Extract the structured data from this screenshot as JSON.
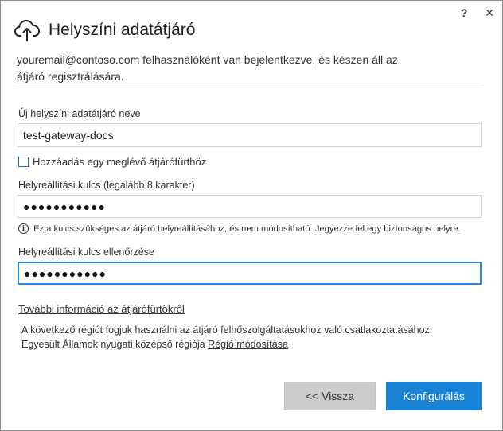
{
  "window": {
    "help_glyph": "?",
    "close_glyph": "✕"
  },
  "header": {
    "title": "Helyszíni adatátjáró",
    "icon": "cloud-upload-icon"
  },
  "intro": {
    "line1": "youremail@contoso.com felhasználóként van bejelentkezve, és készen áll az",
    "line2": "átjáró regisztrálására."
  },
  "form": {
    "name_label": "Új helyszíni adatátjáró neve",
    "name_value": "test-gateway-docs",
    "add_to_cluster_label": "Hozzáadás egy meglévő átjárófürthöz",
    "add_to_cluster_checked": false,
    "recovery_key_label": "Helyreállítási kulcs (legalább 8 karakter)",
    "recovery_key_value": "●●●●●●●●●●●",
    "recovery_key_info": "Ez a kulcs szükséges az átjáró helyreállításához, és nem módosítható. Jegyezze fel egy biztonságos helyre.",
    "confirm_key_label": "Helyreállítási kulcs ellenőrzése",
    "confirm_key_value": "●●●●●●●●●●●"
  },
  "cluster_info_link": "További információ az átjárófürtökről",
  "region": {
    "line1": "A következő régiót fogjuk használni az átjáró felhőszolgáltatásokhoz való csatlakoztatásához:",
    "region_name": "Egyesült Államok nyugati középső régiója",
    "change_link": "Régió módosítása"
  },
  "buttons": {
    "back": "<< Vissza",
    "configure": "Konfigurálás"
  },
  "colors": {
    "accent": "#1883d7",
    "focus_border": "#2a8adf",
    "secondary_button": "#cccccc"
  }
}
